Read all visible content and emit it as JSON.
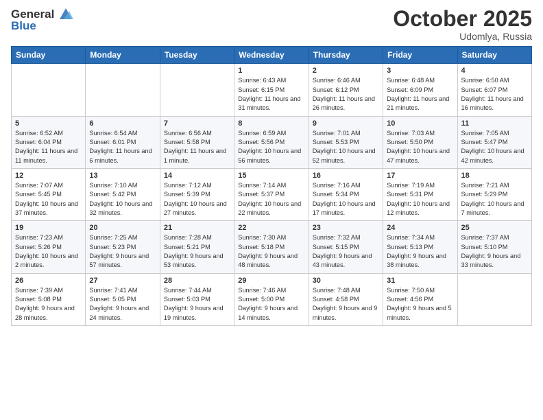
{
  "header": {
    "logo_general": "General",
    "logo_blue": "Blue",
    "month": "October 2025",
    "location": "Udomlya, Russia"
  },
  "weekdays": [
    "Sunday",
    "Monday",
    "Tuesday",
    "Wednesday",
    "Thursday",
    "Friday",
    "Saturday"
  ],
  "weeks": [
    [
      {
        "day": "",
        "sunrise": "",
        "sunset": "",
        "daylight": ""
      },
      {
        "day": "",
        "sunrise": "",
        "sunset": "",
        "daylight": ""
      },
      {
        "day": "",
        "sunrise": "",
        "sunset": "",
        "daylight": ""
      },
      {
        "day": "1",
        "sunrise": "Sunrise: 6:43 AM",
        "sunset": "Sunset: 6:15 PM",
        "daylight": "Daylight: 11 hours and 31 minutes."
      },
      {
        "day": "2",
        "sunrise": "Sunrise: 6:46 AM",
        "sunset": "Sunset: 6:12 PM",
        "daylight": "Daylight: 11 hours and 26 minutes."
      },
      {
        "day": "3",
        "sunrise": "Sunrise: 6:48 AM",
        "sunset": "Sunset: 6:09 PM",
        "daylight": "Daylight: 11 hours and 21 minutes."
      },
      {
        "day": "4",
        "sunrise": "Sunrise: 6:50 AM",
        "sunset": "Sunset: 6:07 PM",
        "daylight": "Daylight: 11 hours and 16 minutes."
      }
    ],
    [
      {
        "day": "5",
        "sunrise": "Sunrise: 6:52 AM",
        "sunset": "Sunset: 6:04 PM",
        "daylight": "Daylight: 11 hours and 11 minutes."
      },
      {
        "day": "6",
        "sunrise": "Sunrise: 6:54 AM",
        "sunset": "Sunset: 6:01 PM",
        "daylight": "Daylight: 11 hours and 6 minutes."
      },
      {
        "day": "7",
        "sunrise": "Sunrise: 6:56 AM",
        "sunset": "Sunset: 5:58 PM",
        "daylight": "Daylight: 11 hours and 1 minute."
      },
      {
        "day": "8",
        "sunrise": "Sunrise: 6:59 AM",
        "sunset": "Sunset: 5:56 PM",
        "daylight": "Daylight: 10 hours and 56 minutes."
      },
      {
        "day": "9",
        "sunrise": "Sunrise: 7:01 AM",
        "sunset": "Sunset: 5:53 PM",
        "daylight": "Daylight: 10 hours and 52 minutes."
      },
      {
        "day": "10",
        "sunrise": "Sunrise: 7:03 AM",
        "sunset": "Sunset: 5:50 PM",
        "daylight": "Daylight: 10 hours and 47 minutes."
      },
      {
        "day": "11",
        "sunrise": "Sunrise: 7:05 AM",
        "sunset": "Sunset: 5:47 PM",
        "daylight": "Daylight: 10 hours and 42 minutes."
      }
    ],
    [
      {
        "day": "12",
        "sunrise": "Sunrise: 7:07 AM",
        "sunset": "Sunset: 5:45 PM",
        "daylight": "Daylight: 10 hours and 37 minutes."
      },
      {
        "day": "13",
        "sunrise": "Sunrise: 7:10 AM",
        "sunset": "Sunset: 5:42 PM",
        "daylight": "Daylight: 10 hours and 32 minutes."
      },
      {
        "day": "14",
        "sunrise": "Sunrise: 7:12 AM",
        "sunset": "Sunset: 5:39 PM",
        "daylight": "Daylight: 10 hours and 27 minutes."
      },
      {
        "day": "15",
        "sunrise": "Sunrise: 7:14 AM",
        "sunset": "Sunset: 5:37 PM",
        "daylight": "Daylight: 10 hours and 22 minutes."
      },
      {
        "day": "16",
        "sunrise": "Sunrise: 7:16 AM",
        "sunset": "Sunset: 5:34 PM",
        "daylight": "Daylight: 10 hours and 17 minutes."
      },
      {
        "day": "17",
        "sunrise": "Sunrise: 7:19 AM",
        "sunset": "Sunset: 5:31 PM",
        "daylight": "Daylight: 10 hours and 12 minutes."
      },
      {
        "day": "18",
        "sunrise": "Sunrise: 7:21 AM",
        "sunset": "Sunset: 5:29 PM",
        "daylight": "Daylight: 10 hours and 7 minutes."
      }
    ],
    [
      {
        "day": "19",
        "sunrise": "Sunrise: 7:23 AM",
        "sunset": "Sunset: 5:26 PM",
        "daylight": "Daylight: 10 hours and 2 minutes."
      },
      {
        "day": "20",
        "sunrise": "Sunrise: 7:25 AM",
        "sunset": "Sunset: 5:23 PM",
        "daylight": "Daylight: 9 hours and 57 minutes."
      },
      {
        "day": "21",
        "sunrise": "Sunrise: 7:28 AM",
        "sunset": "Sunset: 5:21 PM",
        "daylight": "Daylight: 9 hours and 53 minutes."
      },
      {
        "day": "22",
        "sunrise": "Sunrise: 7:30 AM",
        "sunset": "Sunset: 5:18 PM",
        "daylight": "Daylight: 9 hours and 48 minutes."
      },
      {
        "day": "23",
        "sunrise": "Sunrise: 7:32 AM",
        "sunset": "Sunset: 5:15 PM",
        "daylight": "Daylight: 9 hours and 43 minutes."
      },
      {
        "day": "24",
        "sunrise": "Sunrise: 7:34 AM",
        "sunset": "Sunset: 5:13 PM",
        "daylight": "Daylight: 9 hours and 38 minutes."
      },
      {
        "day": "25",
        "sunrise": "Sunrise: 7:37 AM",
        "sunset": "Sunset: 5:10 PM",
        "daylight": "Daylight: 9 hours and 33 minutes."
      }
    ],
    [
      {
        "day": "26",
        "sunrise": "Sunrise: 7:39 AM",
        "sunset": "Sunset: 5:08 PM",
        "daylight": "Daylight: 9 hours and 28 minutes."
      },
      {
        "day": "27",
        "sunrise": "Sunrise: 7:41 AM",
        "sunset": "Sunset: 5:05 PM",
        "daylight": "Daylight: 9 hours and 24 minutes."
      },
      {
        "day": "28",
        "sunrise": "Sunrise: 7:44 AM",
        "sunset": "Sunset: 5:03 PM",
        "daylight": "Daylight: 9 hours and 19 minutes."
      },
      {
        "day": "29",
        "sunrise": "Sunrise: 7:46 AM",
        "sunset": "Sunset: 5:00 PM",
        "daylight": "Daylight: 9 hours and 14 minutes."
      },
      {
        "day": "30",
        "sunrise": "Sunrise: 7:48 AM",
        "sunset": "Sunset: 4:58 PM",
        "daylight": "Daylight: 9 hours and 9 minutes."
      },
      {
        "day": "31",
        "sunrise": "Sunrise: 7:50 AM",
        "sunset": "Sunset: 4:56 PM",
        "daylight": "Daylight: 9 hours and 5 minutes."
      },
      {
        "day": "",
        "sunrise": "",
        "sunset": "",
        "daylight": ""
      }
    ]
  ]
}
